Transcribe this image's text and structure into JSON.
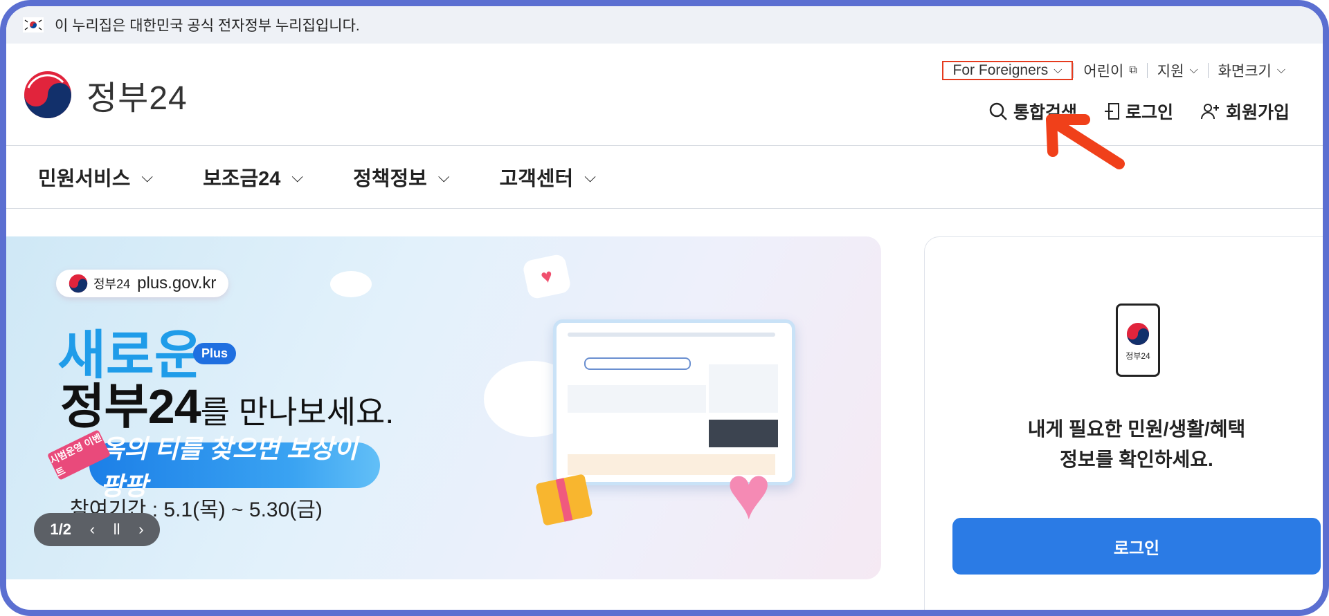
{
  "top_notice": {
    "text": "이 누리집은 대한민국 공식 전자정부 누리집입니다."
  },
  "logo": {
    "text": "정부24"
  },
  "utility_nav": [
    {
      "label": "For Foreigners"
    },
    {
      "label": "어린이"
    },
    {
      "label": "지원"
    },
    {
      "label": "화면크기"
    }
  ],
  "header_actions": {
    "search": "통합검색",
    "login": "로그인",
    "signup": "회원가입"
  },
  "gnb": [
    {
      "label": "민원서비스"
    },
    {
      "label": "보조금24"
    },
    {
      "label": "정책정보"
    },
    {
      "label": "고객센터"
    }
  ],
  "banner": {
    "chip_brand": "정부24",
    "chip_url": "plus.gov.kr",
    "new_word": "새로운",
    "plus_badge": "Plus",
    "headline_big": "정부24",
    "headline_rest": "를 만나보세요.",
    "ribbon": "시범운영 이벤트",
    "event_text": "옥의 티를 찾으면 보상이 팡팡",
    "period": "참여기간 : 5.1(목) ~ 5.30(금)",
    "pager": "1/2"
  },
  "side_panel": {
    "phone_label": "정부24",
    "message_line1": "내게 필요한 민원/생활/혜택",
    "message_line2": "정보를 확인하세요.",
    "login_button": "로그인"
  },
  "colors": {
    "frame": "#5b6fd1",
    "highlight": "#e53b1e",
    "accent": "#2b7be5",
    "headline_blue": "#1f9ce9"
  }
}
